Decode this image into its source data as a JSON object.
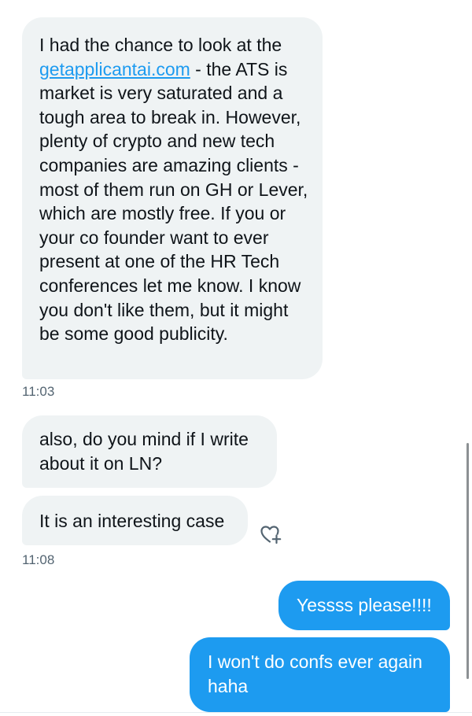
{
  "messages": [
    {
      "link": "getapplicantai.com",
      "before_link": "I had the chance to look at the",
      "after_link": " - the ATS is market is very saturated and a tough area to break in. However, plenty of crypto and new tech companies are amazing clients - most of them run on GH or Lever, which are mostly free. If you or your co founder want to ever present at one of the HR Tech conferences let me know. I know you don't like them, but it might be some good publicity.",
      "time": "11:03"
    },
    {
      "text": "also, do you mind if I write about it on LN?"
    },
    {
      "text": "It is an interesting case",
      "time": "11:08"
    },
    {
      "text": "Yessss please!!!!"
    },
    {
      "text": "I won't do confs ever again haha"
    }
  ],
  "icons": {
    "react": "heart-plus-icon"
  },
  "colors": {
    "incoming_bubble": "#eff3f4",
    "outgoing_bubble": "#1d9bf0",
    "link": "#1d9bf0",
    "timestamp": "#536471"
  }
}
